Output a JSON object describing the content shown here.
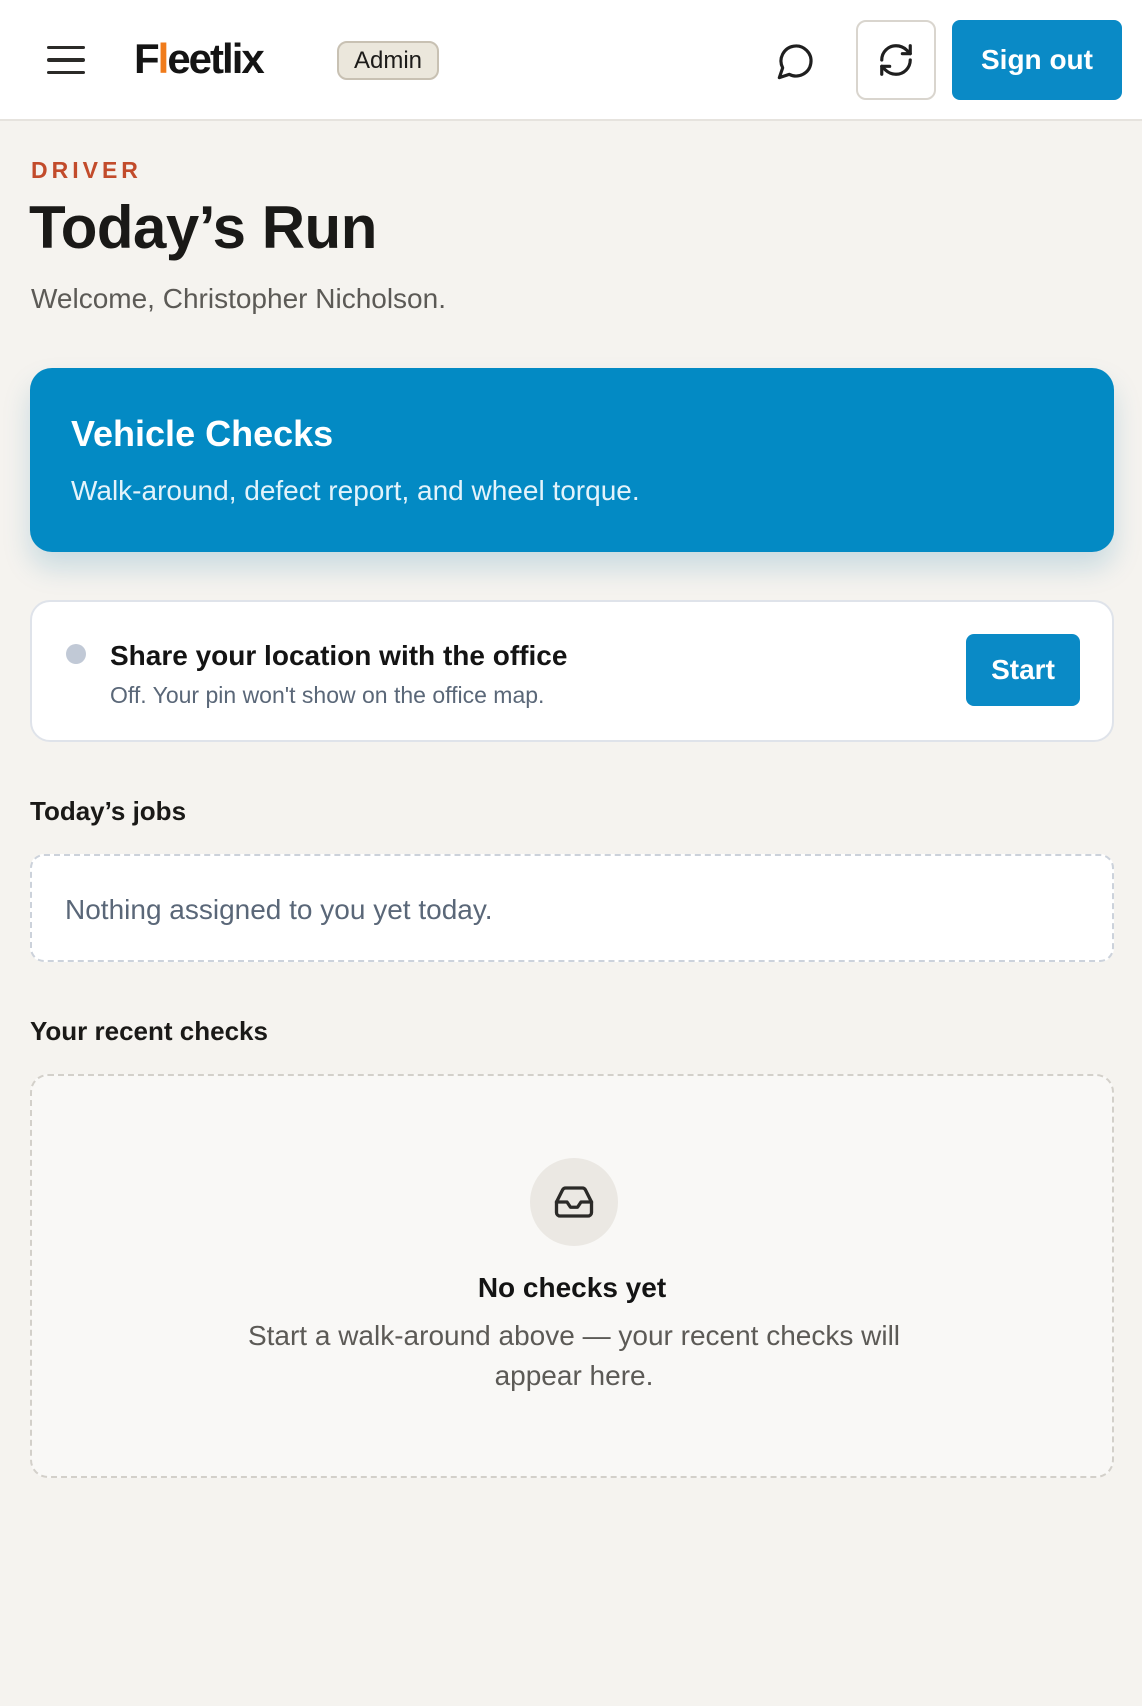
{
  "header": {
    "brand_prefix": "F",
    "brand_accent": "l",
    "brand_suffix": "eetlix",
    "role_badge": "Admin",
    "chat_icon": "chat-bubble-icon",
    "refresh_icon": "refresh-icon",
    "menu_icon": "hamburger-menu-icon",
    "sign_out_label": "Sign out"
  },
  "page": {
    "eyebrow": "DRIVER",
    "title": "Today’s Run",
    "welcome": "Welcome, Christopher Nicholson."
  },
  "vehicle_checks": {
    "title": "Vehicle Checks",
    "subtitle": "Walk-around, defect report, and wheel torque."
  },
  "location": {
    "title": "Share your location with the office",
    "status": "Off. Your pin won't show on the office map.",
    "start_label": "Start"
  },
  "jobs": {
    "heading": "Today’s jobs",
    "empty_text": "Nothing assigned to you yet today."
  },
  "recent_checks": {
    "heading": "Your recent checks",
    "empty_icon": "inbox-icon",
    "empty_title": "No checks yet",
    "empty_desc": "Start a walk-around above — your recent checks will appear here."
  },
  "colors": {
    "primary": "#0a8ac6",
    "brand_accent": "#f07b1a",
    "eyebrow": "#c24b2b",
    "page_background": "#f5f3ef"
  }
}
